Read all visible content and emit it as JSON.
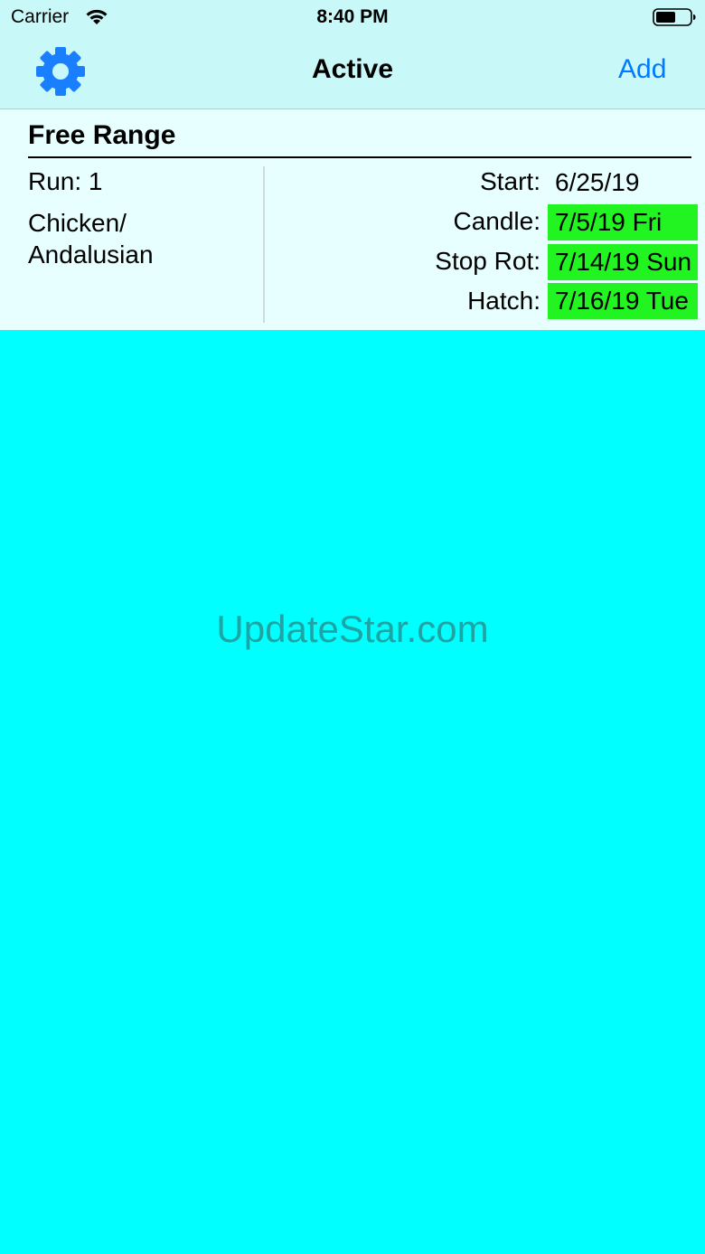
{
  "status_bar": {
    "carrier": "Carrier",
    "time": "8:40 PM",
    "icons": [
      "wifi-icon",
      "battery-icon"
    ]
  },
  "nav": {
    "title": "Active",
    "add_label": "Add",
    "settings_icon": "gear-icon",
    "accent_color": "#007AFF"
  },
  "card": {
    "title": "Free Range",
    "run_label": "Run: 1",
    "species_line1": "Chicken/",
    "species_line2": "Andalusian",
    "dates": [
      {
        "label": "Start:",
        "value": "6/25/19",
        "highlighted": false
      },
      {
        "label": "Candle:",
        "value": "7/5/19 Fri",
        "highlighted": true
      },
      {
        "label": "Stop Rot:",
        "value": "7/14/19 Sun",
        "highlighted": true
      },
      {
        "label": "Hatch:",
        "value": "7/16/19 Tue",
        "highlighted": true
      }
    ],
    "highlight_color": "#22F422"
  },
  "watermark": "UpdateStar.com",
  "colors": {
    "header_bg": "#C9F8F8",
    "card_bg": "#E8FFFF",
    "page_bg": "#00FFFF"
  }
}
